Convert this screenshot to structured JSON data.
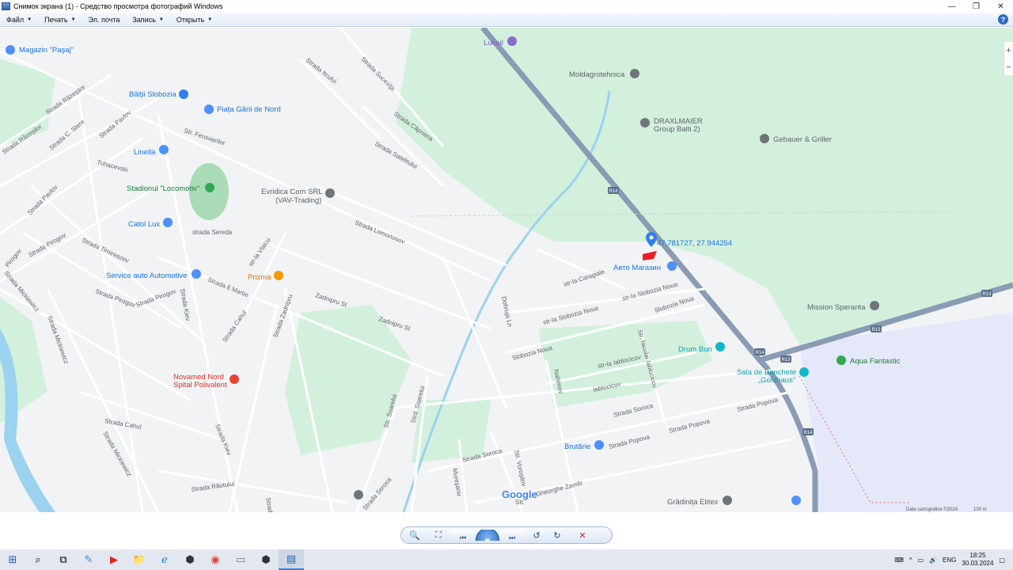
{
  "window": {
    "title": "Снимок экрана (1) - Средство просмотра фотографий Windows",
    "minimize_glyph": "—",
    "maximize_glyph": "❐",
    "close_glyph": "✕"
  },
  "menu": [
    {
      "label": "Файл"
    },
    {
      "label": "Печать"
    },
    {
      "label": "Эл. почта"
    },
    {
      "label": "Запись"
    },
    {
      "label": "Открыть"
    }
  ],
  "help_glyph": "?",
  "map": {
    "labels": {
      "magazin_pasaj": "Magazin \"Paşaj\"",
      "baltii_slobozia": "Bălţii Slobozia",
      "piata_garii": "Piața Gării de Nord",
      "linella": "Linella",
      "stadionul": "Stadionul \"Locomotiv\"",
      "catol_lux": "Catol Lux",
      "service_auto": "Service auto Automotive",
      "prizma": "Prizma",
      "evridica": "Evridica Com SRL",
      "vav_trading": "(VAV-Trading)",
      "lukoil": "Lukoil",
      "moldagrotehnica": "Moldagrotehnica",
      "draxlmaier1": "DRAXLMAIER",
      "draxlmaier2": "Group Balti 2)",
      "gebauer": "Gebauer & Griller",
      "coords": "47.781727, 27.944254",
      "avto_magazin": "Авто Магазин",
      "mission": "Mission Speranta",
      "drum_bun": "Drum Bun",
      "aqua": "Aqua Fantastic",
      "sala1": "Sala de Banchete",
      "sala2": "„Goldhaus\"",
      "novamed1": "Novamed Nord",
      "novamed2": "Spital Polivalent",
      "brutarie": "Brutărie",
      "gradinita": "Grădinița Elitex",
      "google": "Google",
      "strazi": [
        "Strada Răzeșilor",
        "Strada Răzeșilor",
        "Strada C. Stere",
        "Strada Pavlov",
        "Tuhacevski",
        "Str. Feroviarilor",
        "Strada Pavlov",
        "strada Sereda",
        "str-la Vlaicu",
        "Strada Timireazev",
        "Strada Pirogov",
        "Pirogov",
        "Strada Mickiewicz",
        "Strada Pirogov",
        "Strada Pirogov",
        "Strada 8 Martie",
        "Strada Kiev",
        "Strada Cahul",
        "Strada Zadnipru",
        "Zadnipru St",
        "Zadnipru St",
        "Strada Lomonosov",
        "Strada Suceviţa",
        "Strada Itcului",
        "Strada Căpriana",
        "Strada Satelitului",
        "Dobruja Ln",
        "str-la Caragiale",
        "str-la Slobozia Noua",
        "str-la Slobozia Noua",
        "Slobozia Noua",
        "Slobozia Noua",
        "Str. Nicolai Iablocicov",
        "str-la Iablocicov",
        "Iablocicov",
        "Nahimov",
        "Strada Soroca",
        "Strada Soroca",
        "Strada Popova",
        "Strada Popova",
        "Strada Popova",
        "Str. Soarelui",
        "Strd. Soarelui",
        "Strada Cahul",
        "Strada Mickiewicz",
        "Strada Mickiewicz",
        "Strada Kiev",
        "Strada Răutului",
        "Strada Soroca",
        "Mureşanu",
        "Str. Voroşilov",
        "Gheorghe Zamfir",
        "Str.",
        "Strada Răutului"
      ],
      "r14": "R14",
      "r13": "R13",
      "attribution": "Date cartografice ©2024",
      "scale": "100 m"
    }
  },
  "zoom": {
    "plus": "+",
    "minus": "−"
  },
  "controls": {
    "zoom_glyph": "🔍",
    "fit_glyph": "⛶",
    "prev_glyph": "⏮",
    "slideshow_glyph": "▣",
    "next_glyph": "⏭",
    "rotate_ccw_glyph": "↺",
    "rotate_cw_glyph": "↻",
    "delete_glyph": "✕"
  },
  "taskbar": {
    "start": "⊞",
    "search": "⌕",
    "taskview": "⧉",
    "apps": [
      "✎",
      "▶",
      "📁",
      "ℯ",
      "⬢",
      "◉",
      "▭",
      "⬢",
      "▤"
    ],
    "tray": {
      "keyboard": "⌨",
      "chevron": "^",
      "battery": "▭",
      "volume": "🔊",
      "lang": "ENG",
      "time": "18:25",
      "date": "30.03.2024",
      "notifications": "▢"
    }
  }
}
